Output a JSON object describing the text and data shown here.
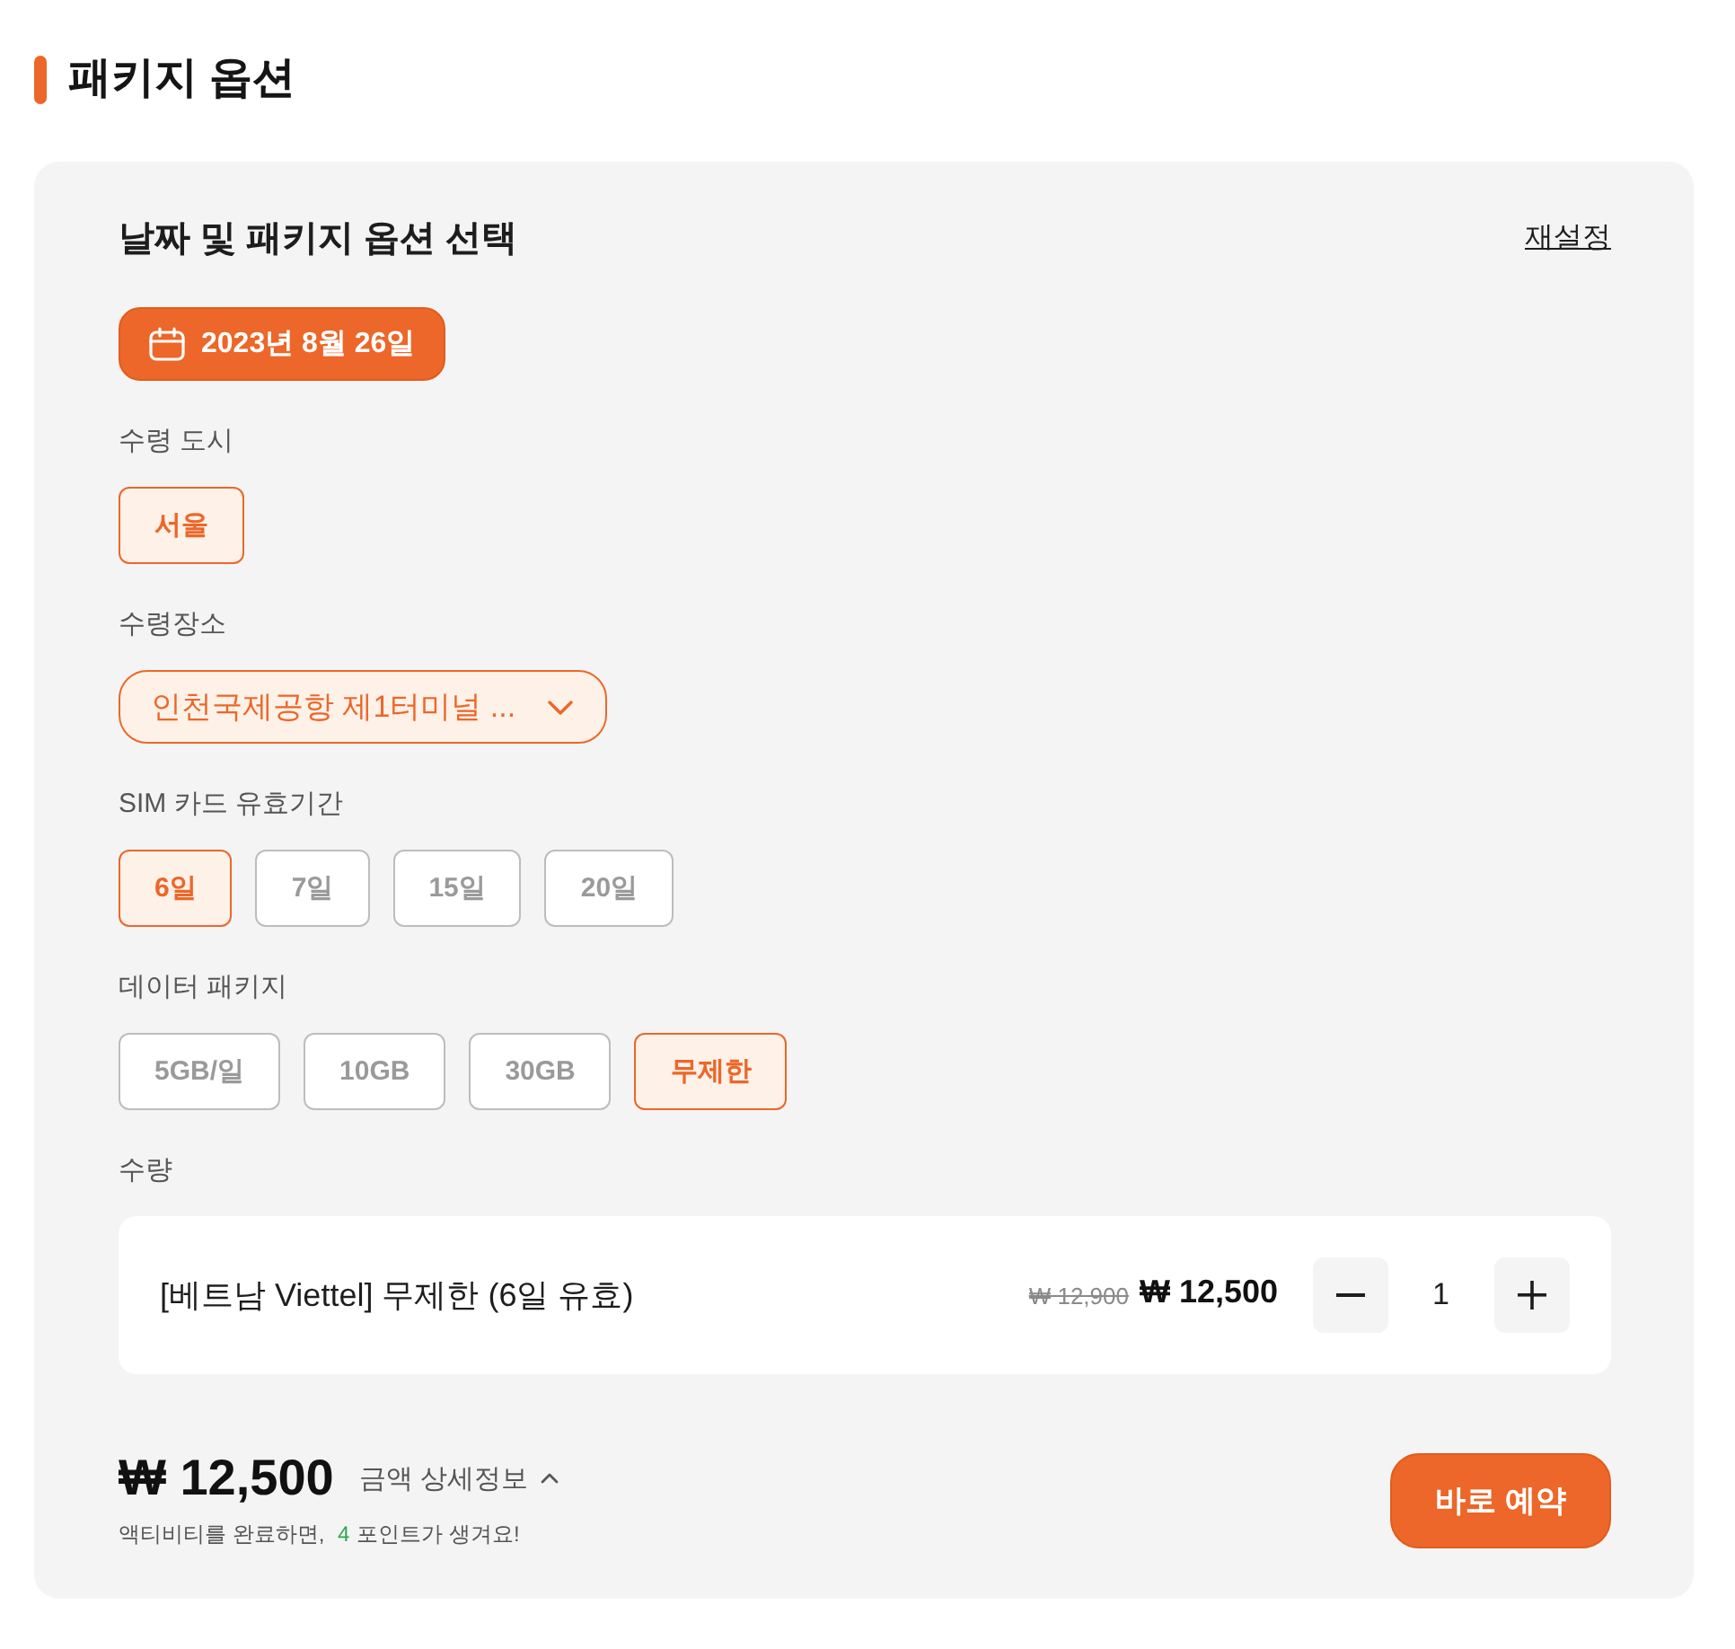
{
  "section": {
    "title": "패키지 옵션"
  },
  "panel": {
    "title": "날짜 및 패키지 옵션 선택",
    "reset_link": "재설정",
    "date_button": "2023년 8월 26일"
  },
  "groups": [
    {
      "kind": "chips",
      "label": "수령 도시",
      "options": [
        {
          "label": "서울",
          "selected": true
        }
      ]
    },
    {
      "kind": "dropdown",
      "label": "수령장소",
      "value": "인천국제공항 제1터미널 ..."
    },
    {
      "kind": "chips",
      "label": "SIM 카드 유효기간",
      "options": [
        {
          "label": "6일",
          "selected": true
        },
        {
          "label": "7일",
          "selected": false
        },
        {
          "label": "15일",
          "selected": false
        },
        {
          "label": "20일",
          "selected": false
        }
      ]
    },
    {
      "kind": "chips",
      "label": "데이터 패키지",
      "options": [
        {
          "label": "5GB/일",
          "selected": false
        },
        {
          "label": "10GB",
          "selected": false
        },
        {
          "label": "30GB",
          "selected": false
        },
        {
          "label": "무제한",
          "selected": true
        }
      ]
    },
    {
      "kind": "product",
      "label": "수량",
      "name": "[베트남 Viettel] 무제한 (6일 유효)",
      "original_price": "₩ 12,900",
      "price": "₩ 12,500",
      "quantity": "1"
    }
  ],
  "footer": {
    "total": "₩ 12,500",
    "details_toggle": "금액 상세정보",
    "note_before": "액티비티를 완료하면,",
    "points": "4",
    "note_after": "포인트가 생겨요!",
    "book_button": "바로 예약"
  }
}
